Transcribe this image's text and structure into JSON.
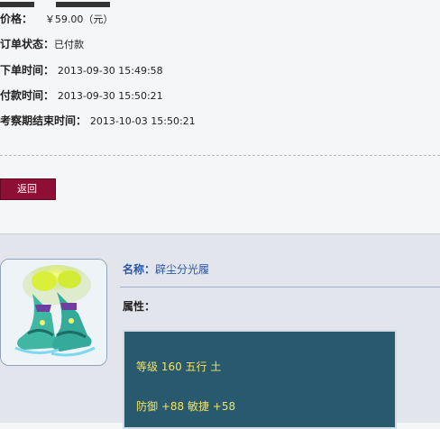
{
  "order": {
    "price_label": "价格：",
    "price_value": "￥59.00（元）",
    "status_label": "订单状态：",
    "status_value": "已付款",
    "order_time_label": "下单时间：",
    "order_time_value": "2013-09-30 15:49:58",
    "pay_time_label": "付款时间：",
    "pay_time_value": "2013-09-30 15:50:21",
    "review_end_label": "考察期结束时间：",
    "review_end_value": "2013-10-03 15:50:21"
  },
  "back_button": "返回",
  "item": {
    "name_label": "名称：",
    "name_value": "辟尘分光履",
    "attr_label": "属性：",
    "attrs": [
      {
        "text": "等级 160 五行 土"
      },
      {
        "text": "防御 +88 敏捷 +58"
      }
    ],
    "icon": "boots-icon"
  },
  "colors": {
    "button": "#8e0f36",
    "attr_bg": "#29596f",
    "attr_text": "#f3e35d",
    "name_text": "#2a55a6"
  }
}
